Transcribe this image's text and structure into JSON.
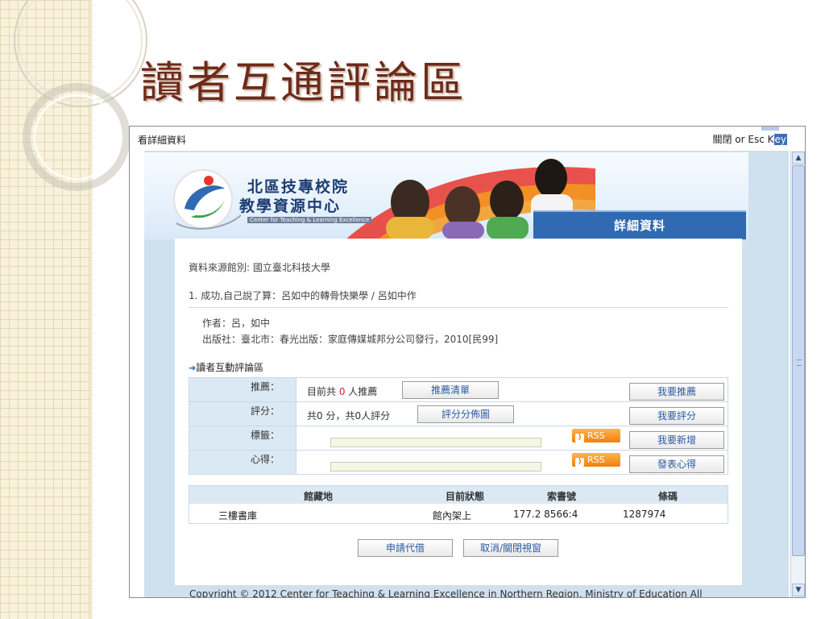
{
  "slide": {
    "title": "讀者互通評論區"
  },
  "window": {
    "title": "看詳細資料",
    "close_link": "關閉",
    "close_hint_prefix": " or Esc K",
    "close_hint_hl": "ey"
  },
  "banner": {
    "logo_line1": "北區技專校院",
    "logo_line2": "教學資源中心",
    "logo_en": "Center for Teaching & Learning Excellence",
    "tab": "詳細資料"
  },
  "record": {
    "source": "資料來源館別: 國立臺北科技大學",
    "title": "1. 成功,自己說了算：呂如中的轉骨快樂學 / 呂如中作",
    "author": "作者：呂，如中",
    "publisher": "出版社：臺北市：春光出版：家庭傳媒城邦分公司發行，2010[民99]"
  },
  "interact": {
    "heading": "讀者互動評論區",
    "rows": {
      "recommend": {
        "label": "推薦：",
        "text_pre": "目前共 ",
        "count": "0",
        "text_post": " 人推薦",
        "list_button": "推薦清單",
        "action_button": "我要推薦"
      },
      "rating": {
        "label": "評分：",
        "text": "共0 分，共0人評分",
        "dist_button": "評分分佈圖",
        "action_button": "我要評分"
      },
      "tags": {
        "label": "標籤：",
        "rss": "RSS",
        "action_button": "我要新增"
      },
      "review": {
        "label": "心得：",
        "rss": "RSS",
        "action_button": "發表心得"
      }
    }
  },
  "holdings": {
    "headers": [
      "館藏地",
      "目前狀態",
      "索書號",
      "條碼"
    ],
    "rows": [
      [
        "三樓書庫",
        "館內架上",
        "177.2 8566:4",
        "1287974"
      ]
    ]
  },
  "actions": {
    "borrow": "申請代借",
    "cancel": "取消/關閉視窗"
  },
  "footer": {
    "copyright": "Copyright © 2012 Center for Teaching & Learning Excellence in Northern Region, Ministry of Education All"
  }
}
